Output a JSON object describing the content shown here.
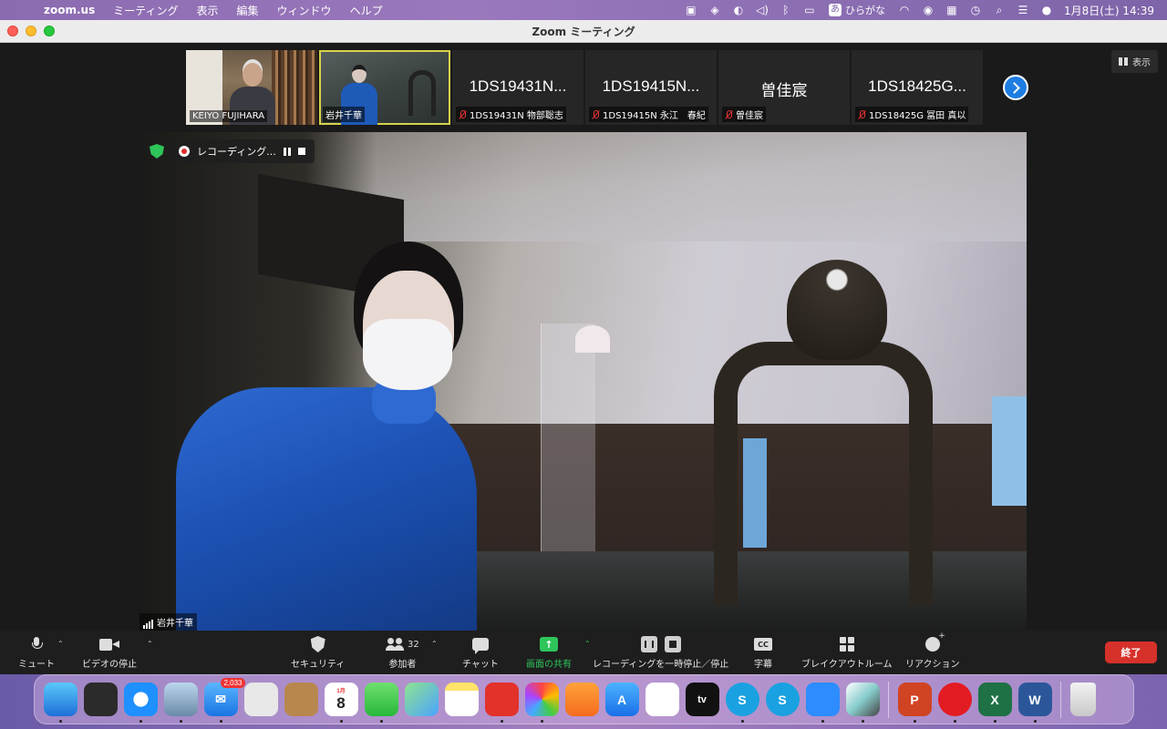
{
  "menubar": {
    "app_name": "zoom.us",
    "menus": [
      "ミーティング",
      "表示",
      "編集",
      "ウィンドウ",
      "ヘルプ"
    ],
    "ime_char": "あ",
    "ime_label": "ひらがな",
    "datetime": "1月8日(土)  14:39"
  },
  "window": {
    "title": "Zoom ミーティング"
  },
  "gallery": {
    "tiles": [
      {
        "name": "KEIYO FUJIHARA",
        "video": true,
        "muted": false
      },
      {
        "name": "岩井千華",
        "video": true,
        "muted": false,
        "active": true
      },
      {
        "display": "1DS19431N...",
        "name": "1DS19431N 物部聡志",
        "video": false,
        "muted": true
      },
      {
        "display": "1DS19415N...",
        "name": "1DS19415N 永江　春紀",
        "video": false,
        "muted": true
      },
      {
        "display": "曽佳宸",
        "name": "曽佳宸",
        "video": false,
        "muted": true
      },
      {
        "display": "1DS18425G...",
        "name": "1DS18425G 冨田 真以",
        "video": false,
        "muted": true
      }
    ],
    "view_label": "表示"
  },
  "main_video": {
    "speaker_name": "岩井千華",
    "recording_label": "レコーディング..."
  },
  "toolbar": {
    "mute": "ミュート",
    "video_stop": "ビデオの停止",
    "security": "セキュリティ",
    "participants": "参加者",
    "participants_count": "32",
    "chat": "チャット",
    "share_screen": "画面の共有",
    "recording_pause_stop": "レコーディングを一時停止／停止",
    "cc_icon_text": "CC",
    "captions": "字幕",
    "breakout": "ブレイクアウトルーム",
    "reactions": "リアクション",
    "end": "終了"
  },
  "dock": {
    "mail_badge": "2,033",
    "calendar_month": "1月",
    "calendar_day": "8",
    "apple_tv_label": "tv"
  }
}
